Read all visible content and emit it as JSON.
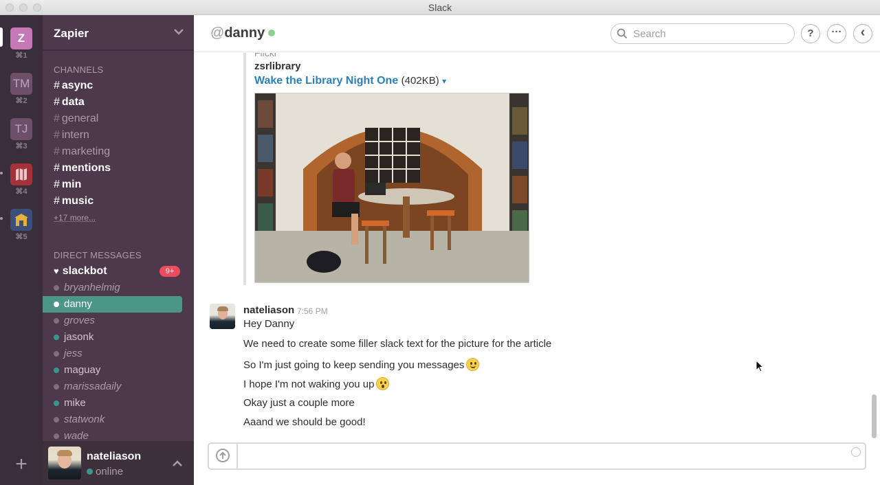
{
  "window": {
    "title": "Slack"
  },
  "teams": [
    {
      "initials": "Z",
      "shortcut": "⌘1",
      "color": "#c478b7",
      "active": true
    },
    {
      "initials": "TM",
      "shortcut": "⌘2",
      "color": "#6e4f6a"
    },
    {
      "initials": "TJ",
      "shortcut": "⌘3",
      "color": "#6e4f6a"
    },
    {
      "initials": "",
      "shortcut": "⌘4",
      "color": "#c0392b",
      "icon": "map-team-icon"
    },
    {
      "initials": "",
      "shortcut": "⌘5",
      "color": "#3c5a8f",
      "icon": "house-team-icon"
    }
  ],
  "sidebar": {
    "team_name": "Zapier",
    "channels_label": "CHANNELS",
    "channels": [
      {
        "name": "async",
        "unread": true
      },
      {
        "name": "data",
        "unread": true
      },
      {
        "name": "general",
        "unread": false
      },
      {
        "name": "intern",
        "unread": false
      },
      {
        "name": "marketing",
        "unread": false
      },
      {
        "name": "mentions",
        "unread": true
      },
      {
        "name": "min",
        "unread": true
      },
      {
        "name": "music",
        "unread": true
      }
    ],
    "more_channels": "+17 more...",
    "dm_label": "DIRECT MESSAGES",
    "dms": [
      {
        "name": "slackbot",
        "status": "bot",
        "badge": "9+"
      },
      {
        "name": "bryanhelmig",
        "status": "away"
      },
      {
        "name": "danny",
        "status": "active",
        "selected": true
      },
      {
        "name": "groves",
        "status": "away"
      },
      {
        "name": "jasonk",
        "status": "active"
      },
      {
        "name": "jess",
        "status": "away"
      },
      {
        "name": "maguay",
        "status": "active"
      },
      {
        "name": "marissadaily",
        "status": "away"
      },
      {
        "name": "mike",
        "status": "active"
      },
      {
        "name": "statwonk",
        "status": "away"
      },
      {
        "name": "wade",
        "status": "away"
      }
    ],
    "user": {
      "name": "nateliason",
      "status": "online"
    }
  },
  "header": {
    "at": "@",
    "channel": "danny",
    "search_placeholder": "Search",
    "help_label": "?",
    "more_label": "···",
    "back_label": "‹"
  },
  "attachment": {
    "service": "Flickr",
    "uploader": "zsrlibrary",
    "title": "Wake the Library Night One",
    "size": "(402KB)",
    "caret": "▾"
  },
  "message": {
    "author": "nateliason",
    "time": "7:56 PM",
    "lines": [
      "Hey Danny",
      "We need to create some filler slack text for the picture for the article",
      "So I'm just going to keep sending you messages",
      "I hope I'm not waking you up",
      "Okay just a couple more",
      "Aaand we should be good!"
    ]
  },
  "composer": {
    "value": "",
    "placeholder": ""
  },
  "colors": {
    "sidebar_bg": "#4d394b",
    "teams_bg": "#3a2e3a",
    "selected_bg": "#4c9689",
    "badge": "#eb4d5c",
    "link": "#2a80b9",
    "presence": "#38978d"
  }
}
